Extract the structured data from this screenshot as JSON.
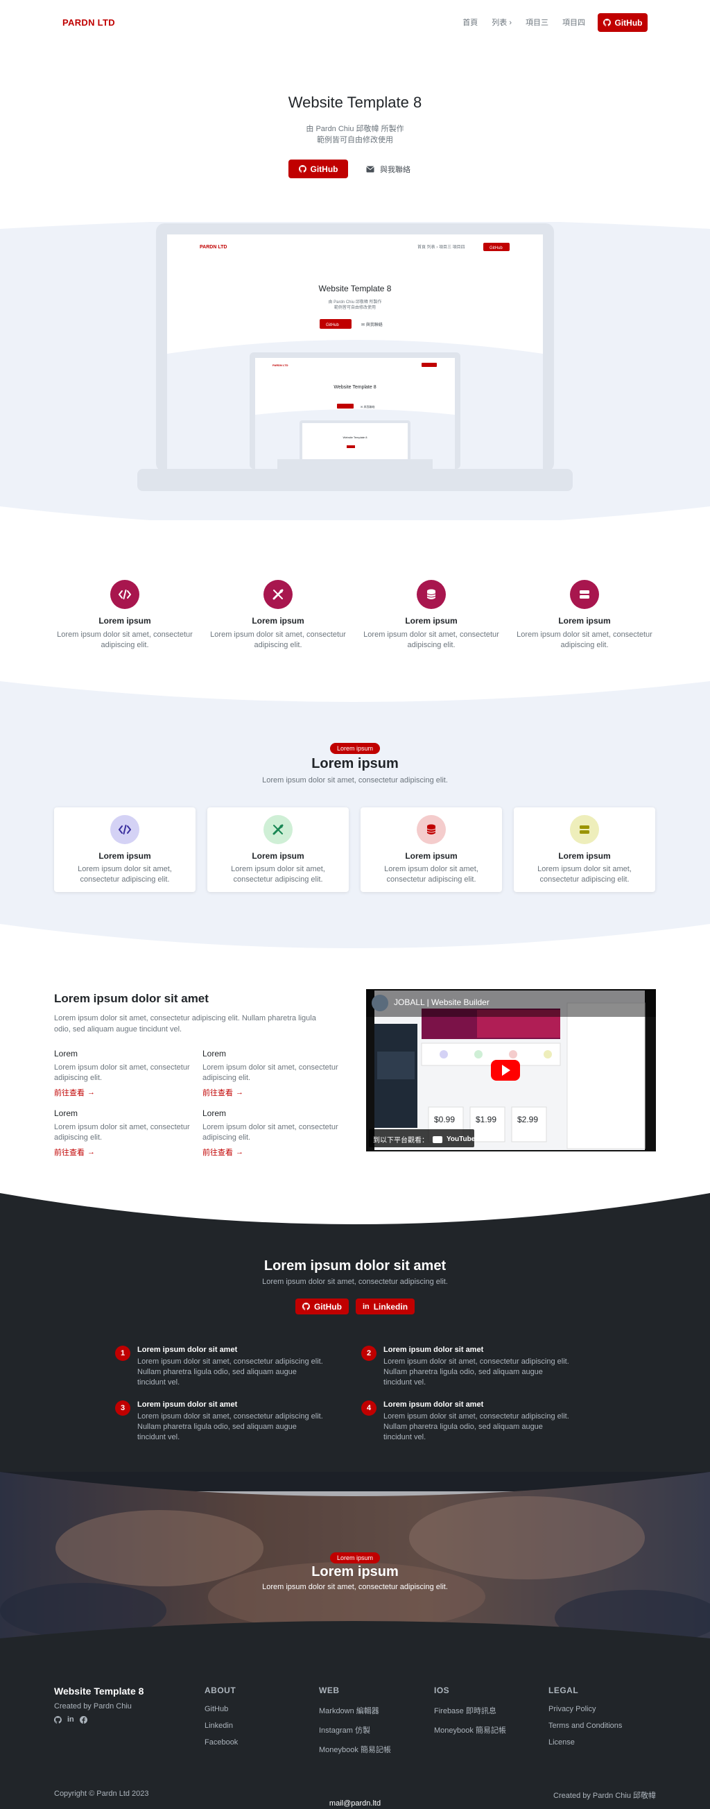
{
  "nav": {
    "brand": "PARDN LTD",
    "links": [
      "首頁",
      "列表",
      "項目三",
      "項目四"
    ],
    "github_label": "GitHub"
  },
  "hero": {
    "title": "Website Template 8",
    "subtitle_1": "由 Pardn Chiu 邱敬幃 所製作",
    "subtitle_2": "範例皆可自由修改使用",
    "github_label": "GitHub",
    "contact_label": "與我聯絡"
  },
  "features": [
    {
      "icon": "code-icon",
      "title": "Lorem ipsum",
      "text": "Lorem ipsum dolor sit amet, consectetur adipiscing elit."
    },
    {
      "icon": "tools-icon",
      "title": "Lorem ipsum",
      "text": "Lorem ipsum dolor sit amet, consectetur adipiscing elit."
    },
    {
      "icon": "database-icon",
      "title": "Lorem ipsum",
      "text": "Lorem ipsum dolor sit amet, consectetur adipiscing elit."
    },
    {
      "icon": "server-icon",
      "title": "Lorem ipsum",
      "text": "Lorem ipsum dolor sit amet, consectetur adipiscing elit."
    }
  ],
  "section2": {
    "badge": "Lorem ipsum",
    "title": "Lorem ipsum",
    "subtitle": "Lorem ipsum dolor sit amet, consectetur adipiscing elit.",
    "cards": [
      {
        "icon": "code-icon",
        "color": "#6f42c1",
        "title": "Lorem ipsum",
        "text": "Lorem ipsum dolor sit amet, consectetur adipiscing elit."
      },
      {
        "icon": "tools-icon",
        "color": "#198754",
        "title": "Lorem ipsum",
        "text": "Lorem ipsum dolor sit amet, consectetur adipiscing elit."
      },
      {
        "icon": "database-icon",
        "color": "#c00000",
        "title": "Lorem ipsum",
        "text": "Lorem ipsum dolor sit amet, consectetur adipiscing elit."
      },
      {
        "icon": "server-icon",
        "color": "#a7a000",
        "title": "Lorem ipsum",
        "text": "Lorem ipsum dolor sit amet, consectetur adipiscing elit."
      }
    ]
  },
  "section3": {
    "title": "Lorem ipsum dolor sit amet",
    "text": "Lorem ipsum dolor sit amet, consectetur adipiscing elit. Nullam pharetra ligula odio, sed aliquam augue tincidunt vel.",
    "items": [
      {
        "title": "Lorem",
        "text": "Lorem ipsum dolor sit amet, consectetur adipiscing elit.",
        "link": "前往查看"
      },
      {
        "title": "Lorem",
        "text": "Lorem ipsum dolor sit amet, consectetur adipiscing elit.",
        "link": "前往查看"
      },
      {
        "title": "Lorem",
        "text": "Lorem ipsum dolor sit amet, consectetur adipiscing elit.",
        "link": "前往查看"
      },
      {
        "title": "Lorem",
        "text": "Lorem ipsum dolor sit amet, consectetur adipiscing elit.",
        "link": "前往查看"
      }
    ],
    "video": {
      "title": "JOBALL | Website Builder",
      "watch_on": "到以下平台觀看：",
      "platform": "YouTube"
    }
  },
  "dark": {
    "title": "Lorem ipsum dolor sit amet",
    "subtitle": "Lorem ipsum dolor sit amet, consectetur adipiscing elit.",
    "github_label": "GitHub",
    "linkedin_label": "Linkedin",
    "steps": [
      {
        "num": "1",
        "title": "Lorem ipsum dolor sit amet",
        "text": "Lorem ipsum dolor sit amet, consectetur adipiscing elit. Nullam pharetra ligula odio, sed aliquam augue tincidunt vel."
      },
      {
        "num": "2",
        "title": "Lorem ipsum dolor sit amet",
        "text": "Lorem ipsum dolor sit amet, consectetur adipiscing elit. Nullam pharetra ligula odio, sed aliquam augue tincidunt vel."
      },
      {
        "num": "3",
        "title": "Lorem ipsum dolor sit amet",
        "text": "Lorem ipsum dolor sit amet, consectetur adipiscing elit. Nullam pharetra ligula odio, sed aliquam augue tincidunt vel."
      },
      {
        "num": "4",
        "title": "Lorem ipsum dolor sit amet",
        "text": "Lorem ipsum dolor sit amet, consectetur adipiscing elit. Nullam pharetra ligula odio, sed aliquam augue tincidunt vel."
      }
    ]
  },
  "photo": {
    "badge": "Lorem ipsum",
    "title": "Lorem ipsum",
    "subtitle": "Lorem ipsum dolor sit amet, consectetur adipiscing elit."
  },
  "footer": {
    "brand": "Website Template 8",
    "created_by": "Created by Pardn Chiu",
    "columns": [
      {
        "title": "ABOUT",
        "links": [
          "GitHub",
          "Linkedin",
          "Facebook"
        ]
      },
      {
        "title": "WEB",
        "links": [
          "Markdown 編輯器",
          "Instagram 仿製",
          "Moneybook 簡易記帳"
        ]
      },
      {
        "title": "IOS",
        "links": [
          "Firebase 即時訊息",
          "Moneybook 簡易記帳"
        ]
      },
      {
        "title": "LEGAL",
        "links": [
          "Privacy Policy",
          "Terms and Conditions",
          "License"
        ]
      }
    ],
    "copyright": "Copyright © Pardn Ltd 2023",
    "created_right": "Created by Pardn Chiu 邱敬幃",
    "email": "mail@pardn.ltd"
  },
  "colors": {
    "accent": "#c00000",
    "feature_icon": "#a8164e",
    "light_band": "#eef2f9",
    "dark": "#212529"
  }
}
